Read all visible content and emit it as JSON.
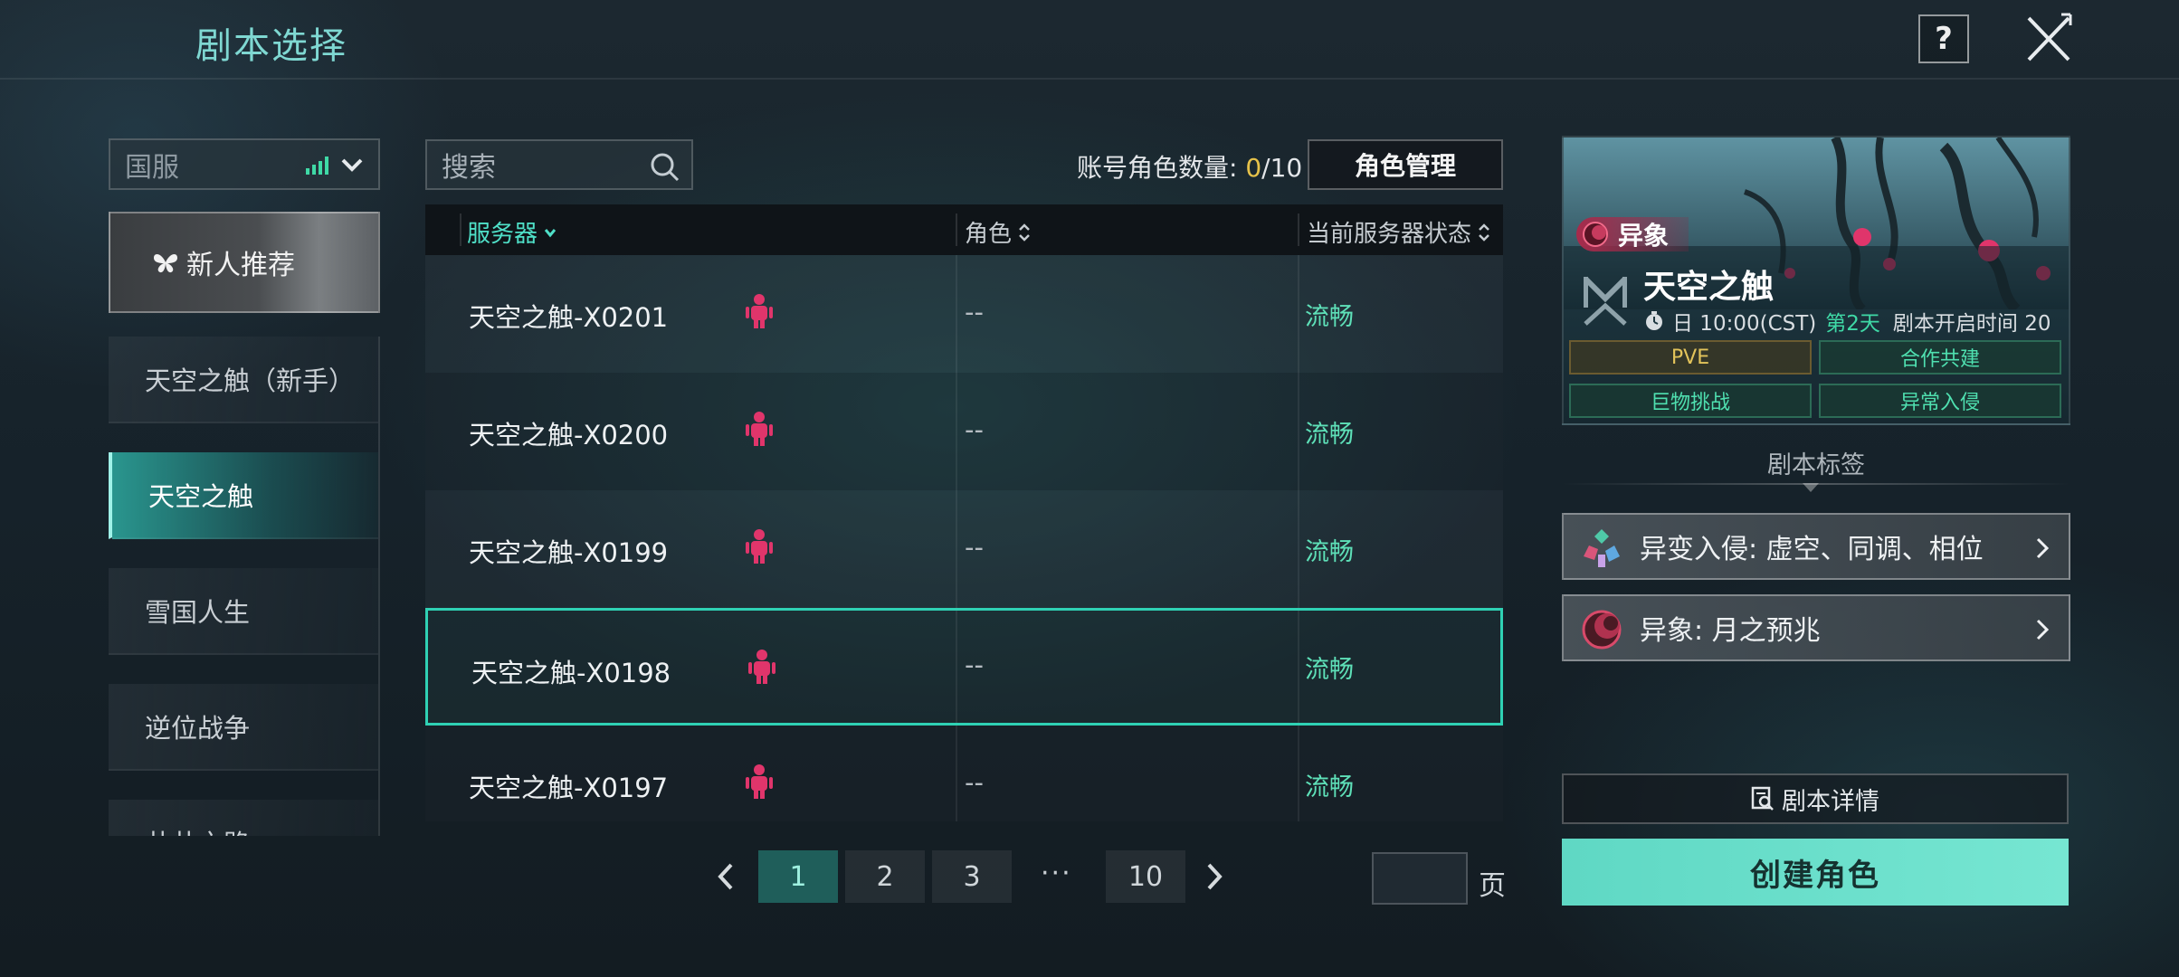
{
  "header": {
    "title": "剧本选择",
    "help_label": "?"
  },
  "region": {
    "selected": "国服"
  },
  "newbie_banner": {
    "label": "新人推荐"
  },
  "scenarios": [
    {
      "label": "天空之触（新手）",
      "active": false
    },
    {
      "label": "天空之触",
      "active": true
    },
    {
      "label": "雪国人生",
      "active": false
    },
    {
      "label": "逆位战争",
      "active": false
    },
    {
      "label": "井井之路",
      "active": false
    }
  ],
  "search": {
    "placeholder": "搜索"
  },
  "account": {
    "label": "账号角色数量:",
    "current": "0",
    "max": "/10",
    "manage_label": "角色管理"
  },
  "table": {
    "headers": {
      "server": "服务器",
      "role": "角色",
      "status": "当前服务器状态"
    },
    "rows": [
      {
        "name": "天空之触-X0201",
        "role": "--",
        "status": "流畅"
      },
      {
        "name": "天空之触-X0200",
        "role": "--",
        "status": "流畅"
      },
      {
        "name": "天空之触-X0199",
        "role": "--",
        "status": "流畅"
      },
      {
        "name": "天空之触-X0198",
        "role": "--",
        "status": "流畅",
        "selected": true
      },
      {
        "name": "天空之触-X0197",
        "role": "--",
        "status": "流畅"
      }
    ]
  },
  "pagination": {
    "pages": [
      "1",
      "2",
      "3"
    ],
    "current": "1",
    "dots": "···",
    "last": "10",
    "page_unit": "页"
  },
  "scenario_card": {
    "badge": "异象",
    "title": "天空之触",
    "schedule_prefix": "日 10:00(CST)",
    "day": "第2天",
    "open_time": "剧本开启时间 20",
    "tags": [
      "PVE",
      "合作共建",
      "巨物挑战",
      "异常入侵"
    ]
  },
  "tags_section": {
    "label": "剧本标签"
  },
  "features": [
    {
      "label": "异变入侵: 虚空、同调、相位",
      "icon": "crystal-cluster-icon"
    },
    {
      "label": "异象: 月之预兆",
      "icon": "moon-omen-icon"
    }
  ],
  "actions": {
    "detail_label": "剧本详情",
    "create_label": "创建角色"
  },
  "colors": {
    "accent": "#4fe0c8",
    "status_ok": "#5ee0b8",
    "create_button": "#6ddfcb",
    "badge": "#a82a4b",
    "count_current": "#e6c24a"
  }
}
